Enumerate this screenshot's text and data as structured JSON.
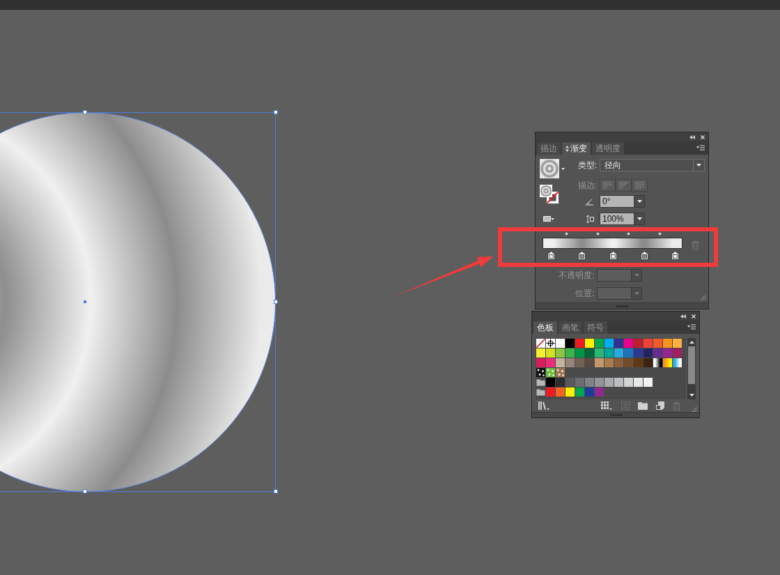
{
  "canvas": {
    "circle": {
      "selected": true
    }
  },
  "gradient_panel": {
    "tabs": [
      {
        "label": "描边",
        "selected": false
      },
      {
        "label": "渐变",
        "selected": true
      },
      {
        "label": "透明度",
        "selected": false
      }
    ],
    "type": {
      "label": "类型:",
      "value": "径向"
    },
    "stroke": {
      "label": "描边:",
      "disabled": true
    },
    "angle": {
      "value": "0°"
    },
    "aspect_ratio": {
      "value": "100%"
    },
    "stops": [
      {
        "color": "#eeeeee"
      },
      {
        "color": "#8e8e8e"
      },
      {
        "color": "#f0f0f0"
      },
      {
        "color": "#8c8c8c"
      },
      {
        "color": "#ebebeb"
      }
    ],
    "delete_stop": {
      "disabled": true
    },
    "opacity": {
      "label": "不透明度:",
      "disabled": true
    },
    "location": {
      "label": "位置:",
      "disabled": true
    }
  },
  "swatches_panel": {
    "tabs": [
      {
        "label": "色板",
        "selected": true
      },
      {
        "label": "画笔",
        "selected": false
      },
      {
        "label": "符号",
        "selected": false
      }
    ],
    "rows": [
      [
        {
          "kind": "none"
        },
        {
          "kind": "registration"
        },
        {
          "kind": "color",
          "color": "#ffffff"
        },
        {
          "kind": "color",
          "color": "#000000"
        },
        {
          "kind": "color",
          "color": "#ed1c24"
        },
        {
          "kind": "color",
          "color": "#fff200"
        },
        {
          "kind": "color",
          "color": "#00a651"
        },
        {
          "kind": "color",
          "color": "#00aeef"
        },
        {
          "kind": "color",
          "color": "#2e3192"
        },
        {
          "kind": "color",
          "color": "#ec008c"
        },
        {
          "kind": "color",
          "color": "#be1e2d"
        },
        {
          "kind": "color",
          "color": "#ef4136"
        },
        {
          "kind": "color",
          "color": "#f15a29"
        },
        {
          "kind": "color",
          "color": "#f7941d"
        },
        {
          "kind": "color",
          "color": "#fbb040"
        }
      ],
      [
        {
          "kind": "color",
          "color": "#f9ed32"
        },
        {
          "kind": "color",
          "color": "#d7df23"
        },
        {
          "kind": "color",
          "color": "#8dc63f"
        },
        {
          "kind": "color",
          "color": "#39b54a"
        },
        {
          "kind": "color",
          "color": "#009444"
        },
        {
          "kind": "color",
          "color": "#006838"
        },
        {
          "kind": "color",
          "color": "#2bb673"
        },
        {
          "kind": "color",
          "color": "#00a79d"
        },
        {
          "kind": "color",
          "color": "#27aae1"
        },
        {
          "kind": "color",
          "color": "#1c75bc"
        },
        {
          "kind": "color",
          "color": "#2b3990"
        },
        {
          "kind": "color",
          "color": "#262262"
        },
        {
          "kind": "color",
          "color": "#662d91"
        },
        {
          "kind": "color",
          "color": "#92278f"
        },
        {
          "kind": "color",
          "color": "#9e1f63"
        }
      ],
      [
        {
          "kind": "color",
          "color": "#da1c5c"
        },
        {
          "kind": "color",
          "color": "#ee2a7b"
        },
        {
          "kind": "color",
          "color": "#c2b59b"
        },
        {
          "kind": "color",
          "color": "#9a8479"
        },
        {
          "kind": "color",
          "color": "#736357"
        },
        {
          "kind": "color",
          "color": "#594a42"
        },
        {
          "kind": "color",
          "color": "#c49a6c"
        },
        {
          "kind": "color",
          "color": "#a97c50"
        },
        {
          "kind": "color",
          "color": "#8b5e3c"
        },
        {
          "kind": "color",
          "color": "#754c29"
        },
        {
          "kind": "color",
          "color": "#603913"
        },
        {
          "kind": "color",
          "color": "#3c2415"
        },
        {
          "kind": "gradient",
          "stops": [
            {
              "color": "#ffffff"
            },
            {
              "color": "#000000"
            }
          ]
        },
        {
          "kind": "gradient",
          "stops": [
            {
              "color": "#f7941d"
            },
            {
              "color": "#fff200"
            }
          ]
        },
        {
          "kind": "gradient",
          "stops": [
            {
              "color": "#27aae1"
            },
            {
              "color": "#ffffff"
            }
          ]
        }
      ],
      [
        {
          "kind": "pattern",
          "color": "#111111"
        },
        {
          "kind": "pattern",
          "color": "#6cbf3c"
        },
        {
          "kind": "pattern",
          "color": "#a07850"
        }
      ],
      [
        {
          "kind": "group"
        },
        {
          "kind": "color",
          "color": "#000000"
        },
        {
          "kind": "color",
          "color": "#2e2e2e"
        },
        {
          "kind": "color",
          "color": "#58595b"
        },
        {
          "kind": "color",
          "color": "#6d6e71"
        },
        {
          "kind": "color",
          "color": "#808285"
        },
        {
          "kind": "color",
          "color": "#939598"
        },
        {
          "kind": "color",
          "color": "#a7a9ac"
        },
        {
          "kind": "color",
          "color": "#bcbec0"
        },
        {
          "kind": "color",
          "color": "#d1d3d4"
        },
        {
          "kind": "color",
          "color": "#e6e7e8"
        },
        {
          "kind": "color",
          "color": "#f1f2f2"
        }
      ],
      [
        {
          "kind": "group"
        },
        {
          "kind": "color",
          "color": "#ed1c24"
        },
        {
          "kind": "color",
          "color": "#f26522"
        },
        {
          "kind": "color",
          "color": "#fff200"
        },
        {
          "kind": "color",
          "color": "#00a651"
        },
        {
          "kind": "color",
          "color": "#1b3c9c"
        },
        {
          "kind": "color",
          "color": "#92278f"
        }
      ]
    ],
    "toolbar": [
      {
        "kind": "library",
        "disabled": false
      },
      {
        "kind": "kinds-menu",
        "disabled": false
      },
      {
        "kind": "options",
        "disabled": true
      },
      {
        "kind": "new-group",
        "disabled": false
      },
      {
        "kind": "new-swatch",
        "disabled": false
      },
      {
        "kind": "delete",
        "disabled": true
      }
    ]
  }
}
